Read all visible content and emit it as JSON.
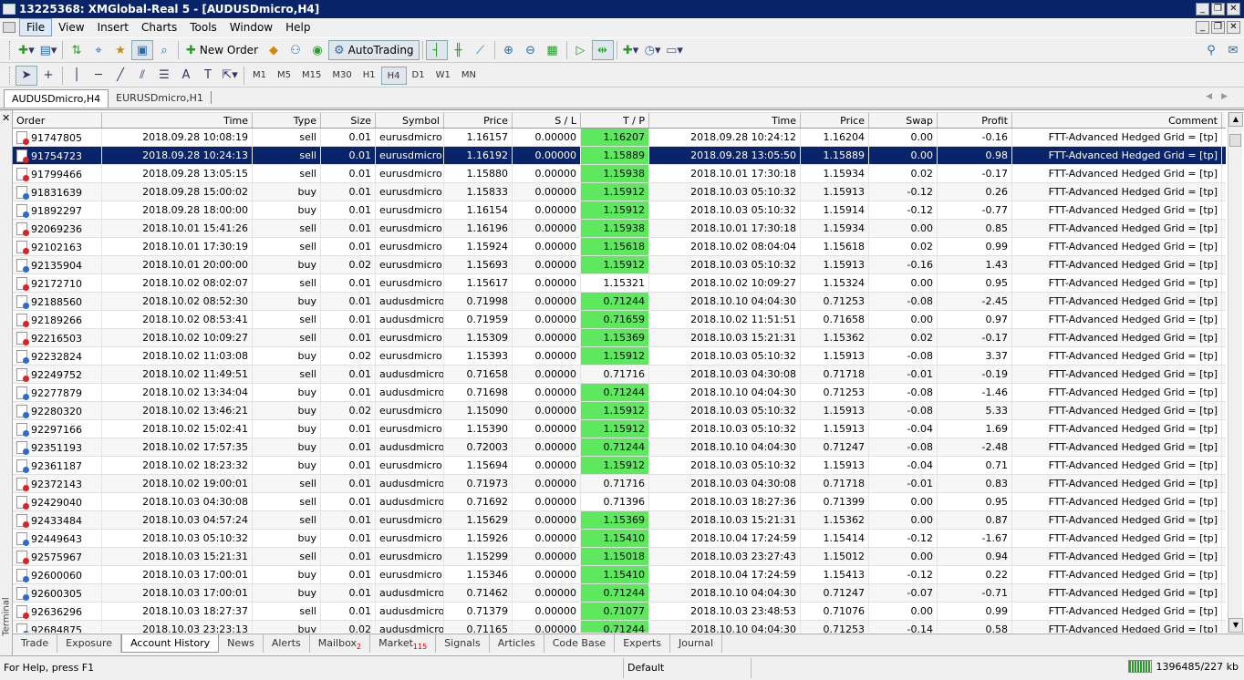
{
  "window": {
    "title": "13225368: XMGlobal-Real 5 - [AUDUSDmicro,H4]",
    "buttons": [
      "_",
      "❐",
      "✕"
    ]
  },
  "menu": [
    "File",
    "View",
    "Insert",
    "Charts",
    "Tools",
    "Window",
    "Help"
  ],
  "toolbar": {
    "new_order": "New Order",
    "autotrading": "AutoTrading"
  },
  "timeframes": [
    "M1",
    "M5",
    "M15",
    "M30",
    "H1",
    "H4",
    "D1",
    "W1",
    "MN"
  ],
  "active_timeframe": "H4",
  "chart_tabs": [
    "AUDUSDmicro,H4",
    "EURUSDmicro,H1"
  ],
  "terminal": {
    "side_label": "Terminal",
    "columns": [
      "Order",
      "Time",
      "Type",
      "Size",
      "Symbol",
      "Price",
      "S / L",
      "T / P",
      "Time",
      "Price",
      "Swap",
      "Profit",
      "Comment"
    ],
    "rows": [
      [
        "91747805",
        "2018.09.28 10:08:19",
        "sell",
        "0.01",
        "eurusdmicro",
        "1.16157",
        "0.00000",
        "1.16207",
        "2018.09.28 10:24:12",
        "1.16204",
        "0.00",
        "-0.16",
        "FTT-Advanced Hedged Grid = [tp]"
      ],
      [
        "91754723",
        "2018.09.28 10:24:13",
        "sell",
        "0.01",
        "eurusdmicro",
        "1.16192",
        "0.00000",
        "1.15889",
        "2018.09.28 13:05:50",
        "1.15889",
        "0.00",
        "0.98",
        "FTT-Advanced Hedged Grid = [tp]"
      ],
      [
        "91799466",
        "2018.09.28 13:05:15",
        "sell",
        "0.01",
        "eurusdmicro",
        "1.15880",
        "0.00000",
        "1.15938",
        "2018.10.01 17:30:18",
        "1.15934",
        "0.02",
        "-0.17",
        "FTT-Advanced Hedged Grid = [tp]"
      ],
      [
        "91831639",
        "2018.09.28 15:00:02",
        "buy",
        "0.01",
        "eurusdmicro",
        "1.15833",
        "0.00000",
        "1.15912",
        "2018.10.03 05:10:32",
        "1.15913",
        "-0.12",
        "0.26",
        "FTT-Advanced Hedged Grid = [tp]"
      ],
      [
        "91892297",
        "2018.09.28 18:00:00",
        "buy",
        "0.01",
        "eurusdmicro",
        "1.16154",
        "0.00000",
        "1.15912",
        "2018.10.03 05:10:32",
        "1.15914",
        "-0.12",
        "-0.77",
        "FTT-Advanced Hedged Grid = [tp]"
      ],
      [
        "92069236",
        "2018.10.01 15:41:26",
        "sell",
        "0.01",
        "eurusdmicro",
        "1.16196",
        "0.00000",
        "1.15938",
        "2018.10.01 17:30:18",
        "1.15934",
        "0.00",
        "0.85",
        "FTT-Advanced Hedged Grid = [tp]"
      ],
      [
        "92102163",
        "2018.10.01 17:30:19",
        "sell",
        "0.01",
        "eurusdmicro",
        "1.15924",
        "0.00000",
        "1.15618",
        "2018.10.02 08:04:04",
        "1.15618",
        "0.02",
        "0.99",
        "FTT-Advanced Hedged Grid = [tp]"
      ],
      [
        "92135904",
        "2018.10.01 20:00:00",
        "buy",
        "0.02",
        "eurusdmicro",
        "1.15693",
        "0.00000",
        "1.15912",
        "2018.10.03 05:10:32",
        "1.15913",
        "-0.16",
        "1.43",
        "FTT-Advanced Hedged Grid = [tp]"
      ],
      [
        "92172710",
        "2018.10.02 08:02:07",
        "sell",
        "0.01",
        "eurusdmicro",
        "1.15617",
        "0.00000",
        "1.15321",
        "2018.10.02 10:09:27",
        "1.15324",
        "0.00",
        "0.95",
        "FTT-Advanced Hedged Grid = [tp]"
      ],
      [
        "92188560",
        "2018.10.02 08:52:30",
        "buy",
        "0.01",
        "audusdmicro",
        "0.71998",
        "0.00000",
        "0.71244",
        "2018.10.10 04:04:30",
        "0.71253",
        "-0.08",
        "-2.45",
        "FTT-Advanced Hedged Grid = [tp]"
      ],
      [
        "92189266",
        "2018.10.02 08:53:41",
        "sell",
        "0.01",
        "audusdmicro",
        "0.71959",
        "0.00000",
        "0.71659",
        "2018.10.02 11:51:51",
        "0.71658",
        "0.00",
        "0.97",
        "FTT-Advanced Hedged Grid = [tp]"
      ],
      [
        "92216503",
        "2018.10.02 10:09:27",
        "sell",
        "0.01",
        "eurusdmicro",
        "1.15309",
        "0.00000",
        "1.15369",
        "2018.10.03 15:21:31",
        "1.15362",
        "0.02",
        "-0.17",
        "FTT-Advanced Hedged Grid = [tp]"
      ],
      [
        "92232824",
        "2018.10.02 11:03:08",
        "buy",
        "0.02",
        "eurusdmicro",
        "1.15393",
        "0.00000",
        "1.15912",
        "2018.10.03 05:10:32",
        "1.15913",
        "-0.08",
        "3.37",
        "FTT-Advanced Hedged Grid = [tp]"
      ],
      [
        "92249752",
        "2018.10.02 11:49:51",
        "sell",
        "0.01",
        "audusdmicro",
        "0.71658",
        "0.00000",
        "0.71716",
        "2018.10.03 04:30:08",
        "0.71718",
        "-0.01",
        "-0.19",
        "FTT-Advanced Hedged Grid = [tp]"
      ],
      [
        "92277879",
        "2018.10.02 13:34:04",
        "buy",
        "0.01",
        "audusdmicro",
        "0.71698",
        "0.00000",
        "0.71244",
        "2018.10.10 04:04:30",
        "0.71253",
        "-0.08",
        "-1.46",
        "FTT-Advanced Hedged Grid = [tp]"
      ],
      [
        "92280320",
        "2018.10.02 13:46:21",
        "buy",
        "0.02",
        "eurusdmicro",
        "1.15090",
        "0.00000",
        "1.15912",
        "2018.10.03 05:10:32",
        "1.15913",
        "-0.08",
        "5.33",
        "FTT-Advanced Hedged Grid = [tp]"
      ],
      [
        "92297166",
        "2018.10.02 15:02:41",
        "buy",
        "0.01",
        "eurusdmicro",
        "1.15390",
        "0.00000",
        "1.15912",
        "2018.10.03 05:10:32",
        "1.15913",
        "-0.04",
        "1.69",
        "FTT-Advanced Hedged Grid = [tp]"
      ],
      [
        "92351193",
        "2018.10.02 17:57:35",
        "buy",
        "0.01",
        "audusdmicro",
        "0.72003",
        "0.00000",
        "0.71244",
        "2018.10.10 04:04:30",
        "0.71247",
        "-0.08",
        "-2.48",
        "FTT-Advanced Hedged Grid = [tp]"
      ],
      [
        "92361187",
        "2018.10.02 18:23:32",
        "buy",
        "0.01",
        "eurusdmicro",
        "1.15694",
        "0.00000",
        "1.15912",
        "2018.10.03 05:10:32",
        "1.15913",
        "-0.04",
        "0.71",
        "FTT-Advanced Hedged Grid = [tp]"
      ],
      [
        "92372143",
        "2018.10.02 19:00:01",
        "sell",
        "0.01",
        "audusdmicro",
        "0.71973",
        "0.00000",
        "0.71716",
        "2018.10.03 04:30:08",
        "0.71718",
        "-0.01",
        "0.83",
        "FTT-Advanced Hedged Grid = [tp]"
      ],
      [
        "92429040",
        "2018.10.03 04:30:08",
        "sell",
        "0.01",
        "audusdmicro",
        "0.71692",
        "0.00000",
        "0.71396",
        "2018.10.03 18:27:36",
        "0.71399",
        "0.00",
        "0.95",
        "FTT-Advanced Hedged Grid = [tp]"
      ],
      [
        "92433484",
        "2018.10.03 04:57:24",
        "sell",
        "0.01",
        "eurusdmicro",
        "1.15629",
        "0.00000",
        "1.15369",
        "2018.10.03 15:21:31",
        "1.15362",
        "0.00",
        "0.87",
        "FTT-Advanced Hedged Grid = [tp]"
      ],
      [
        "92449643",
        "2018.10.03 05:10:32",
        "buy",
        "0.01",
        "eurusdmicro",
        "1.15926",
        "0.00000",
        "1.15410",
        "2018.10.04 17:24:59",
        "1.15414",
        "-0.12",
        "-1.67",
        "FTT-Advanced Hedged Grid = [tp]"
      ],
      [
        "92575967",
        "2018.10.03 15:21:31",
        "sell",
        "0.01",
        "eurusdmicro",
        "1.15299",
        "0.00000",
        "1.15018",
        "2018.10.03 23:27:43",
        "1.15012",
        "0.00",
        "0.94",
        "FTT-Advanced Hedged Grid = [tp]"
      ],
      [
        "92600060",
        "2018.10.03 17:00:01",
        "buy",
        "0.01",
        "eurusdmicro",
        "1.15346",
        "0.00000",
        "1.15410",
        "2018.10.04 17:24:59",
        "1.15413",
        "-0.12",
        "0.22",
        "FTT-Advanced Hedged Grid = [tp]"
      ],
      [
        "92600305",
        "2018.10.03 17:00:01",
        "buy",
        "0.01",
        "audusdmicro",
        "0.71462",
        "0.00000",
        "0.71244",
        "2018.10.10 04:04:30",
        "0.71247",
        "-0.07",
        "-0.71",
        "FTT-Advanced Hedged Grid = [tp]"
      ],
      [
        "92636296",
        "2018.10.03 18:27:37",
        "sell",
        "0.01",
        "audusdmicro",
        "0.71379",
        "0.00000",
        "0.71077",
        "2018.10.03 23:48:53",
        "0.71076",
        "0.00",
        "0.99",
        "FTT-Advanced Hedged Grid = [tp]"
      ],
      [
        "92684875",
        "2018.10.03 23:23:13",
        "buy",
        "0.02",
        "audusdmicro",
        "0.71165",
        "0.00000",
        "0.71244",
        "2018.10.10 04:04:30",
        "0.71253",
        "-0.14",
        "0.58",
        "FTT-Advanced Hedged Grid = [tp]"
      ]
    ],
    "selected_row": 1,
    "tp_highlight_rows": [
      0,
      1,
      2,
      3,
      4,
      5,
      6,
      7,
      9,
      10,
      11,
      12,
      14,
      15,
      16,
      17,
      18,
      21,
      22,
      23,
      24,
      25,
      26,
      27
    ],
    "tabs": [
      {
        "label": "Trade"
      },
      {
        "label": "Exposure"
      },
      {
        "label": "Account History",
        "active": true
      },
      {
        "label": "News"
      },
      {
        "label": "Alerts"
      },
      {
        "label": "Mailbox",
        "badge": "2"
      },
      {
        "label": "Market",
        "badge": "115"
      },
      {
        "label": "Signals"
      },
      {
        "label": "Articles"
      },
      {
        "label": "Code Base"
      },
      {
        "label": "Experts"
      },
      {
        "label": "Journal"
      }
    ]
  },
  "status": {
    "help": "For Help, press F1",
    "profile": "Default",
    "traffic": "1396485/227 kb"
  }
}
